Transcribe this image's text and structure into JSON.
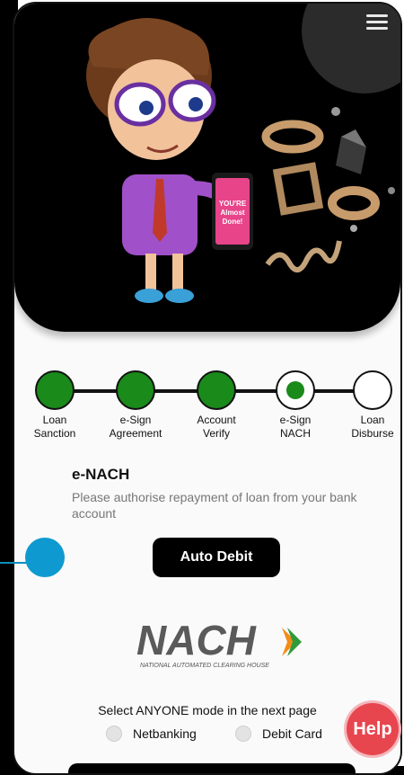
{
  "hero": {
    "card_text": "YOU'RE Almost Done!"
  },
  "stepper": {
    "steps": [
      {
        "label": "Loan\nSanction",
        "state": "complete"
      },
      {
        "label": "e-Sign\nAgreement",
        "state": "complete"
      },
      {
        "label": "Account\nVerify",
        "state": "complete"
      },
      {
        "label": "e-Sign\nNACH",
        "state": "current"
      },
      {
        "label": "Loan\nDisburse",
        "state": "pending"
      }
    ]
  },
  "section": {
    "title": "e-NACH",
    "description": "Please authorise repayment of loan from your bank account"
  },
  "auto_debit_label": "Auto Debit",
  "nach": {
    "logo_text": "NACH",
    "logo_subtext": "NATIONAL AUTOMATED CLEARING HOUSE"
  },
  "mode": {
    "prompt": "Select ANYONE mode in the next page",
    "options": [
      "Netbanking",
      "Debit Card"
    ]
  },
  "help_label": "Help",
  "colors": {
    "complete": "#1a8a1a",
    "accent": "#0e9ad0",
    "help": "#e8464f"
  }
}
